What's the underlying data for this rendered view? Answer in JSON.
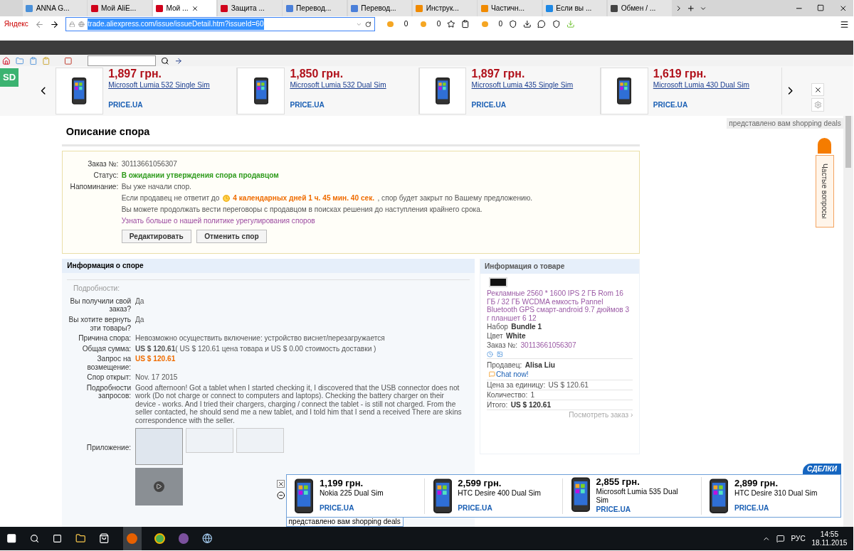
{
  "browser": {
    "tabs": [
      {
        "label": "ANNA G...",
        "kind": "site",
        "selected": false
      },
      {
        "label": "Мой AliE...",
        "kind": "ali",
        "selected": false
      },
      {
        "label": "Мой ...",
        "kind": "ali",
        "selected": true
      },
      {
        "label": "Защита ...",
        "kind": "ali",
        "selected": false
      },
      {
        "label": "Перевод...",
        "kind": "doc",
        "selected": false
      },
      {
        "label": "Перевод...",
        "kind": "doc",
        "selected": false
      },
      {
        "label": "Инструк...",
        "kind": "box",
        "selected": false
      },
      {
        "label": "Частичн...",
        "kind": "box",
        "selected": false
      },
      {
        "label": "Если вы ...",
        "kind": "search",
        "selected": false
      },
      {
        "label": "Обмен / ...",
        "kind": "script",
        "selected": false
      }
    ],
    "search_engine": "Яндекс",
    "url": "trade.aliexpress.com/issue/issueDetail.htm?issueId=60",
    "counters": [
      "0",
      "0",
      "0"
    ]
  },
  "ad_strip": {
    "badge": "SD",
    "items": [
      {
        "price": "1,897 грн.",
        "name": "Microsoft Lumia 532 Single Sim",
        "source": "PRICE.UA"
      },
      {
        "price": "1,850 грн.",
        "name": "Microsoft Lumia 532 Dual Sim",
        "source": "PRICE.UA"
      },
      {
        "price": "1,897 грн.",
        "name": "Microsoft Lumia 435 Single Sim",
        "source": "PRICE.UA"
      },
      {
        "price": "1,619 грн.",
        "name": "Microsoft Lumia 430 Dual Sim",
        "source": "PRICE.UA"
      }
    ],
    "footer": "представлено вам shopping deals"
  },
  "dispute": {
    "title": "Описание спора",
    "order_label": "Заказ №:",
    "order": "30113661056307",
    "status_label": "Статус:",
    "status": "В ожидании утверждения спора продавцом",
    "reminder_label": "Напоминание:",
    "reminder": "Вы уже начали спор.",
    "deadline_before": "Если продавец не ответит до",
    "deadline": "4 календарных дней 1 ч. 45 мин. 40 сек.",
    "deadline_after": ", спор будет закрыт по Вашему предложению.",
    "note": "Вы можете продолжать вести переговоры с продавцом в поисках решения до наступления крайнего срока.",
    "policy_link": "Узнать больше о нашей политике урегулирования споров",
    "buttons": [
      "Редактировать",
      "Отменить спор"
    ]
  },
  "dispute_info": {
    "title": "Информация о споре",
    "subtitle": "Подробности:",
    "rows": [
      {
        "label": "Вы получили свой заказ?",
        "value": "Да",
        "kind": "text"
      },
      {
        "label": "Вы хотите вернуть эти товары?",
        "value": "Да",
        "kind": "text"
      },
      {
        "label": "Причина спора:",
        "value": "Невозможно осуществить включение: устройство виснет/перезагружается",
        "kind": "text"
      },
      {
        "label": "Общая сумма:",
        "value": "**US $ 120.61**( US $ 120.61 цена товара и US $ 0.00 стоимость доставки )",
        "kind": "rich"
      },
      {
        "label": "Запрос на возмещение:",
        "value": "US $ 120.61",
        "kind": "amount"
      },
      {
        "label": "Спор открыт:",
        "value": "Nov. 17 2015",
        "kind": "text"
      },
      {
        "label": "Подробности запросов:",
        "value": "Good afternoon! Got a tablet when I started checking it, I discovered that the USB connector does not work (Do not charge or connect to computers and laptops). Checking the battery charger on their device - works. And I tried their chargers, charging / connect the tablet - is still not charged. From the seller contacted, he should send me a new tablet, and I told him that I send a received There are skins correspondence with the seller.",
        "kind": "text"
      }
    ],
    "attachments_label": "Приложение:"
  },
  "product_info": {
    "title": "Информация о товаре",
    "name": "Рекламные 2560 * 1600 IPS 2 ГБ Rom 16 ГБ / 32 ГБ WCDMA емкость Pannel Bluetooth GPS смарт-android 9.7 дюймов 3 г планшет 6 12",
    "details": [
      {
        "label": "Набор",
        "value": "Bundle 1",
        "kind": "bold"
      },
      {
        "label": "Цвет",
        "value": "White",
        "kind": "bold"
      },
      {
        "label": "Заказ №:",
        "value": "30113661056307",
        "kind": "link"
      }
    ],
    "seller_label": "Продавец:",
    "seller": "Alisa Liu",
    "chat": "Chat now!",
    "totals": [
      {
        "label": "Цена за единицу:",
        "value": "US $ 120.61",
        "kind": "plain"
      },
      {
        "label": "Количество:",
        "value": "1",
        "kind": "plain"
      },
      {
        "label": "Итого:",
        "value": "US $ 120.61",
        "kind": "bold"
      }
    ],
    "view_order": "Посмотреть заказ ›"
  },
  "help_tab": "Частые вопросы",
  "deals_bar": {
    "badge": "СДЕЛКИ",
    "items": [
      {
        "price": "1,199 грн.",
        "name": "Nokia 225 Dual Sim",
        "source": "PRICE.UA"
      },
      {
        "price": "2,599 грн.",
        "name": "HTC Desire 400 Dual Sim",
        "source": "PRICE.UA"
      },
      {
        "price": "2,855 грн.",
        "name": "Microsoft Lumia 535 Dual Sim",
        "source": "PRICE.UA"
      },
      {
        "price": "2,899 грн.",
        "name": "HTC Desire 310 Dual Sim",
        "source": "PRICE.UA"
      }
    ],
    "footer": "представлено вам shopping deals"
  },
  "taskbar": {
    "language": "РУС",
    "time": "14:55",
    "date": "18.11.2015"
  }
}
